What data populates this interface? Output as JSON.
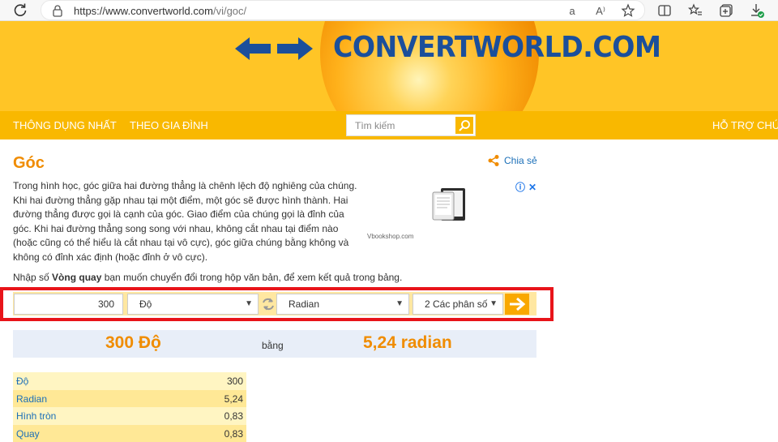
{
  "browser": {
    "url_host": "https://www.convertworld.com",
    "url_path": "/vi/goc/",
    "read_aloud": "aあ",
    "text_size": "A⁾"
  },
  "header": {
    "logo_text": "CONVERTWORLD.COM"
  },
  "nav": {
    "items": [
      "THÔNG DỤNG NHẤT",
      "THEO GIA ĐÌNH"
    ],
    "help": "HỖ TRỢ CHÚNG",
    "search_placeholder": "Tìm kiếm"
  },
  "content": {
    "title": "Góc",
    "share_label": "Chia sẻ",
    "intro": "Trong hình học, góc giữa hai đường thẳng là chênh lệch độ nghiêng của chúng. Khi hai đường thẳng gặp nhau tại một điểm, một góc sẽ được hình thành. Hai đường thẳng được gọi là cạnh của góc. Giao điểm của chúng gọi là đỉnh của góc. Khi hai đường thẳng song song với nhau, không cắt nhau tại điểm nào (hoặc cũng có thể hiểu là cắt nhau tại vô cực), góc giữa chúng bằng không và không có đỉnh xác định (hoặc đỉnh ở vô cực).",
    "instruction_pre": "Nhập số ",
    "instruction_bold": "Vòng quay",
    "instruction_post": " bạn muốn chuyển đổi trong hộp văn bản, để xem kết quả trong bảng.",
    "ad_label": "Vbookshop.com"
  },
  "converter": {
    "value": "300",
    "from_unit": "Độ",
    "to_unit": "Radian",
    "decimals": "2 Các phân số"
  },
  "result": {
    "from_text": "300 Độ",
    "equals": "bằng",
    "to_text": "5,24 radian"
  },
  "table": [
    {
      "name": "Độ",
      "value": "300"
    },
    {
      "name": "Radian",
      "value": "5,24"
    },
    {
      "name": "Hình tròn",
      "value": "0,83"
    },
    {
      "name": "Quay",
      "value": "0,83"
    }
  ],
  "colors": {
    "brand_orange": "#f08c00",
    "header_yellow": "#ffc526",
    "nav_yellow": "#f9b800",
    "logo_blue": "#1b4f9b",
    "link_blue": "#1b6fb8",
    "highlight_red": "#e8141a"
  }
}
